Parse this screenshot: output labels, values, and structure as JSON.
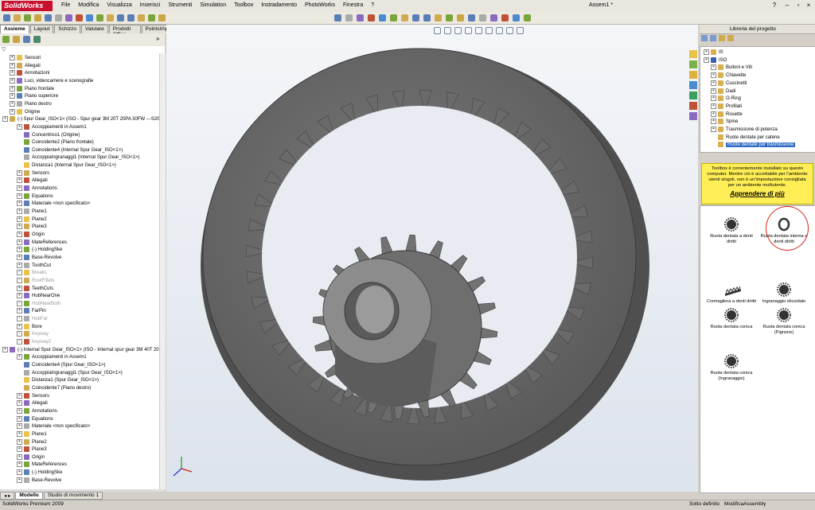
{
  "app": {
    "name": "SolidWorks",
    "title": "Assem1 *",
    "status_left": "SolidWorks Premium 2009",
    "status_mid": "Sotto definito",
    "status_right": "ModificaAssembly"
  },
  "menu": [
    "File",
    "Modifica",
    "Visualizza",
    "Inserisci",
    "Strumenti",
    "Simulation",
    "Toolbox",
    "Instradamento",
    "PhotoWorks",
    "Finestra",
    "?"
  ],
  "left_tabs": [
    "Assieme",
    "Layout",
    "Schizzo",
    "Valutare",
    "Prodotti Office",
    "PointsImport"
  ],
  "bottom_tabs": [
    "Modello",
    "Studio di movimento 1"
  ],
  "tree": [
    {
      "label": "Sensori",
      "level": 1
    },
    {
      "label": "Allegati",
      "level": 1
    },
    {
      "label": "Annotazioni",
      "level": 1
    },
    {
      "label": "Luci, videocamere e scenografie",
      "level": 1
    },
    {
      "label": "Piano frontale",
      "level": 1
    },
    {
      "label": "Piano superiore",
      "level": 1
    },
    {
      "label": "Piano destro",
      "level": 1
    },
    {
      "label": "Origine",
      "level": 1
    },
    {
      "label": "(-) Spur Gear_ISO<1> (ISO - Spur gear 3M 20T 20PA 30FW ---S20B4",
      "level": 0
    },
    {
      "label": "Accoppiamenti in Assem1",
      "level": 2
    },
    {
      "label": "Concentrico1 (Origine)",
      "level": 3
    },
    {
      "label": "Coincidente2 (Piano frontale)",
      "level": 3
    },
    {
      "label": "Coincidente4 (Internal Spur Gear_ISO<1>)",
      "level": 3
    },
    {
      "label": "AccoppiaIngranaggi1 (Internal Spur Gear_ISO<1>)",
      "level": 3
    },
    {
      "label": "Distanza1 (Internal Spur Gear_ISO<1>)",
      "level": 3
    },
    {
      "label": "Sensors",
      "level": 2
    },
    {
      "label": "Allegati",
      "level": 2
    },
    {
      "label": "Annotations",
      "level": 2
    },
    {
      "label": "Equations",
      "level": 2
    },
    {
      "label": "Materiale <non specificato>",
      "level": 2
    },
    {
      "label": "Plane1",
      "level": 2
    },
    {
      "label": "Plane2",
      "level": 2
    },
    {
      "label": "Plane3",
      "level": 2
    },
    {
      "label": "Origin",
      "level": 2
    },
    {
      "label": "MateReferences",
      "level": 2
    },
    {
      "label": "(-) HoldingSke",
      "level": 2
    },
    {
      "label": "Base-Revolve",
      "level": 2
    },
    {
      "label": "ToothCut",
      "level": 2
    },
    {
      "label": "Breaks",
      "level": 2,
      "dim": true
    },
    {
      "label": "RootFillets",
      "level": 2,
      "dim": true
    },
    {
      "label": "TeethCuts",
      "level": 2
    },
    {
      "label": "HubNearOne",
      "level": 2
    },
    {
      "label": "HubNearBoth",
      "level": 2,
      "dim": true
    },
    {
      "label": "FarPin",
      "level": 2
    },
    {
      "label": "HubFar",
      "level": 2,
      "dim": true
    },
    {
      "label": "Bore",
      "level": 2
    },
    {
      "label": "Keyway",
      "level": 2,
      "dim": true
    },
    {
      "label": "Keyway2",
      "level": 2,
      "dim": true
    },
    {
      "label": "(-) Internal Spur Gear_ISO<1> (ISO - Internal spur gear 3M 40T 20P",
      "level": 0
    },
    {
      "label": "Accoppiamenti in Assem1",
      "level": 2
    },
    {
      "label": "Coincidente4 (Spur Gear_ISO<1>)",
      "level": 3
    },
    {
      "label": "AccoppiaIngranaggi1 (Spur Gear_ISO<1>)",
      "level": 3
    },
    {
      "label": "Distanza1 (Spur Gear_ISO<1>)",
      "level": 3
    },
    {
      "label": "Coincidente7 (Piano destro)",
      "level": 3
    },
    {
      "label": "Sensors",
      "level": 2
    },
    {
      "label": "Allegati",
      "level": 2
    },
    {
      "label": "Annotations",
      "level": 2
    },
    {
      "label": "Equations",
      "level": 2
    },
    {
      "label": "Materiale <non specificato>",
      "level": 2
    },
    {
      "label": "Plane1",
      "level": 2
    },
    {
      "label": "Plane2",
      "level": 2
    },
    {
      "label": "Plane3",
      "level": 2
    },
    {
      "label": "Origin",
      "level": 2
    },
    {
      "label": "MateReferences",
      "level": 2
    },
    {
      "label": "(-) HoldingSke",
      "level": 2
    },
    {
      "label": "Base-Revolve",
      "level": 2
    }
  ],
  "right": {
    "header": "Libreria del progetto",
    "lib_tree": [
      {
        "label": "IS",
        "level": 0
      },
      {
        "label": "ISO",
        "level": 0
      },
      {
        "label": "Bulloni e Viti",
        "level": 1
      },
      {
        "label": "Chiavette",
        "level": 1
      },
      {
        "label": "Cuscinetti",
        "level": 1
      },
      {
        "label": "Dadi",
        "level": 1
      },
      {
        "label": "O-Ring",
        "level": 1
      },
      {
        "label": "Profilati",
        "level": 1
      },
      {
        "label": "Rosette",
        "level": 1
      },
      {
        "label": "Spine",
        "level": 1
      },
      {
        "label": "Trasmissione di potenza",
        "level": 1
      },
      {
        "label": "Ruote dentate per catene",
        "level": 2
      },
      {
        "label": "Ruote dentate per trasmissione",
        "level": 2,
        "selected": true
      }
    ],
    "warning_text": "Toolbox è correntemente installato su questo computer. Mentre ciò è accettabile per l'ambiente utenti singoli, non è un'impostazione consigliata per un ambiente multiutente.",
    "warning_link": "Apprendere di più",
    "parts": [
      {
        "label": "Ruota dentata a denti diritti",
        "icon": "spur-gear-icon"
      },
      {
        "label": "Ruota dentata interna a denti diritti",
        "icon": "internal-gear-icon",
        "highlight": true
      },
      {
        "label": "Cremagliera a denti diritti",
        "icon": "rack-icon"
      },
      {
        "label": "Ingranaggio elicoidale",
        "icon": "helical-gear-icon"
      },
      {
        "label": "Ruota dentata conica",
        "icon": "bevel-gear-icon"
      },
      {
        "label": "Ruota dentata conica (Pignone)",
        "icon": "bevel-pinion-icon"
      },
      {
        "label": "Ruota dentata conica (Ingranaggio)",
        "icon": "bevel-crown-icon"
      }
    ]
  },
  "colors": {
    "accent": "#c8102e",
    "gear": "#6e6e6e",
    "warning": "#ffee55",
    "selection": "#316ac5"
  }
}
